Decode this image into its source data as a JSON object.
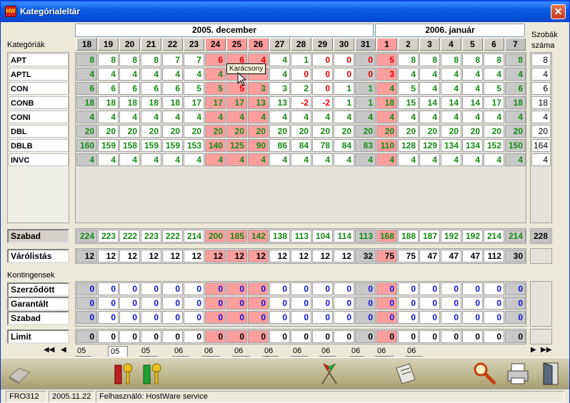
{
  "window": {
    "title": "Kategórialeltár",
    "close_label": "✕",
    "icon_label": "HW"
  },
  "months": [
    {
      "label": "2005. december"
    },
    {
      "label": "2006. január"
    }
  ],
  "days": [
    "18",
    "19",
    "20",
    "21",
    "22",
    "23",
    "24",
    "25",
    "26",
    "27",
    "28",
    "29",
    "30",
    "31",
    "1",
    "2",
    "3",
    "4",
    "5",
    "6",
    "7"
  ],
  "day_types": [
    "we",
    "n",
    "n",
    "n",
    "n",
    "n",
    "hol",
    "hol",
    "hol",
    "n",
    "n",
    "n",
    "n",
    "we",
    "hol",
    "n",
    "n",
    "n",
    "n",
    "n",
    "we"
  ],
  "labels": {
    "categories": "Kategóriák",
    "rooms_count": "Szobák száma",
    "contingents": "Kontingensek"
  },
  "categories": [
    {
      "name": "APT",
      "values": [
        "8",
        "8",
        "8",
        "8",
        "7",
        "7",
        "6",
        "6",
        "4",
        "4",
        "1",
        "0",
        "0",
        "0",
        "5",
        "8",
        "8",
        "8",
        "8",
        "8",
        "8"
      ],
      "colors": [
        "g",
        "g",
        "g",
        "g",
        "g",
        "g",
        "r",
        "r",
        "r",
        "g",
        "g",
        "r",
        "r",
        "r",
        "r",
        "g",
        "g",
        "g",
        "g",
        "g",
        "g"
      ],
      "total": "8"
    },
    {
      "name": "APTL",
      "values": [
        "4",
        "4",
        "4",
        "4",
        "4",
        "4",
        "4",
        "",
        "",
        "4",
        "0",
        "0",
        "0",
        "0",
        "3",
        "4",
        "4",
        "4",
        "4",
        "4",
        "4"
      ],
      "colors": [
        "g",
        "g",
        "g",
        "g",
        "g",
        "g",
        "g",
        "g",
        "g",
        "g",
        "r",
        "r",
        "r",
        "r",
        "r",
        "g",
        "g",
        "g",
        "g",
        "g",
        "g"
      ],
      "total": "4"
    },
    {
      "name": "CON",
      "values": [
        "6",
        "6",
        "6",
        "6",
        "6",
        "5",
        "5",
        "5",
        "3",
        "3",
        "2",
        "0",
        "1",
        "1",
        "4",
        "5",
        "4",
        "4",
        "4",
        "5",
        "6"
      ],
      "colors": [
        "g",
        "g",
        "g",
        "g",
        "g",
        "g",
        "g",
        "r",
        "g",
        "g",
        "g",
        "r",
        "g",
        "g",
        "g",
        "g",
        "g",
        "g",
        "g",
        "g",
        "g"
      ],
      "total": "6"
    },
    {
      "name": "CONB",
      "values": [
        "18",
        "18",
        "18",
        "18",
        "18",
        "17",
        "17",
        "17",
        "13",
        "13",
        "-2",
        "-2",
        "1",
        "1",
        "18",
        "15",
        "14",
        "14",
        "14",
        "17",
        "18"
      ],
      "colors": [
        "g",
        "g",
        "g",
        "g",
        "g",
        "g",
        "g",
        "g",
        "g",
        "g",
        "r",
        "r",
        "g",
        "g",
        "g",
        "g",
        "g",
        "g",
        "g",
        "g",
        "g"
      ],
      "total": "18"
    },
    {
      "name": "CONI",
      "values": [
        "4",
        "4",
        "4",
        "4",
        "4",
        "4",
        "4",
        "4",
        "4",
        "4",
        "4",
        "4",
        "4",
        "4",
        "4",
        "4",
        "4",
        "4",
        "4",
        "4",
        "4"
      ],
      "colors": [
        "g",
        "g",
        "g",
        "g",
        "g",
        "g",
        "g",
        "g",
        "g",
        "g",
        "g",
        "g",
        "g",
        "g",
        "g",
        "g",
        "g",
        "g",
        "g",
        "g",
        "g"
      ],
      "total": "4"
    },
    {
      "name": "DBL",
      "values": [
        "20",
        "20",
        "20",
        "20",
        "20",
        "20",
        "20",
        "20",
        "20",
        "20",
        "20",
        "20",
        "20",
        "20",
        "20",
        "20",
        "20",
        "20",
        "20",
        "20",
        "20"
      ],
      "colors": [
        "g",
        "g",
        "g",
        "g",
        "g",
        "g",
        "g",
        "g",
        "g",
        "g",
        "g",
        "g",
        "g",
        "g",
        "g",
        "g",
        "g",
        "g",
        "g",
        "g",
        "g"
      ],
      "total": "20"
    },
    {
      "name": "DBLB",
      "values": [
        "160",
        "159",
        "158",
        "159",
        "159",
        "153",
        "140",
        "125",
        "90",
        "86",
        "84",
        "78",
        "84",
        "83",
        "110",
        "128",
        "129",
        "134",
        "134",
        "152",
        "150"
      ],
      "colors": [
        "g",
        "g",
        "g",
        "g",
        "g",
        "g",
        "g",
        "g",
        "g",
        "g",
        "g",
        "g",
        "g",
        "g",
        "g",
        "g",
        "g",
        "g",
        "g",
        "g",
        "g"
      ],
      "total": "164"
    },
    {
      "name": "INVC",
      "values": [
        "4",
        "4",
        "4",
        "4",
        "4",
        "4",
        "4",
        "4",
        "4",
        "4",
        "4",
        "4",
        "4",
        "4",
        "4",
        "4",
        "4",
        "4",
        "4",
        "4",
        "4"
      ],
      "colors": [
        "g",
        "g",
        "g",
        "g",
        "g",
        "g",
        "g",
        "g",
        "g",
        "g",
        "g",
        "g",
        "g",
        "g",
        "g",
        "g",
        "g",
        "g",
        "g",
        "g",
        "g"
      ],
      "total": "4"
    }
  ],
  "free": {
    "name": "Szabad",
    "values": [
      "224",
      "223",
      "222",
      "223",
      "222",
      "214",
      "200",
      "185",
      "142",
      "138",
      "113",
      "104",
      "114",
      "113",
      "168",
      "188",
      "187",
      "192",
      "192",
      "214",
      "214"
    ],
    "total": "228"
  },
  "waitlist": {
    "name": "Várólistás",
    "values": [
      "12",
      "12",
      "12",
      "12",
      "12",
      "12",
      "12",
      "12",
      "12",
      "12",
      "12",
      "12",
      "12",
      "32",
      "75",
      "75",
      "47",
      "47",
      "47",
      "112",
      "30"
    ]
  },
  "contingent_rows": [
    {
      "name": "Szerződött",
      "values": [
        "0",
        "0",
        "0",
        "0",
        "0",
        "0",
        "0",
        "0",
        "0",
        "0",
        "0",
        "0",
        "0",
        "0",
        "0",
        "0",
        "0",
        "0",
        "0",
        "0",
        "0"
      ]
    },
    {
      "name": "Garantált",
      "values": [
        "0",
        "0",
        "0",
        "0",
        "0",
        "0",
        "0",
        "0",
        "0",
        "0",
        "0",
        "0",
        "0",
        "0",
        "0",
        "0",
        "0",
        "0",
        "0",
        "0",
        "0"
      ]
    },
    {
      "name": "Szabad",
      "values": [
        "0",
        "0",
        "0",
        "0",
        "0",
        "0",
        "0",
        "0",
        "0",
        "0",
        "0",
        "0",
        "0",
        "0",
        "0",
        "0",
        "0",
        "0",
        "0",
        "0",
        "0"
      ]
    }
  ],
  "limit": {
    "name": "Limit",
    "values": [
      "0",
      "0",
      "0",
      "0",
      "0",
      "0",
      "0",
      "0",
      "0",
      "0",
      "0",
      "0",
      "0",
      "0",
      "0",
      "0",
      "0",
      "0",
      "0",
      "0",
      "0"
    ]
  },
  "tooltip": "Karácsony",
  "tabs": [
    "05 Okt",
    "05 Nov",
    "05 Dec",
    "06 Jan",
    "06 Feb",
    "06 Mar",
    "06 Ápr",
    "06 Máj",
    "06 Jún",
    "06 Júl",
    "06 Aug",
    "06 Sze"
  ],
  "active_tab": "05 Nov",
  "nav": {
    "first": "◀◀",
    "prev": "◀",
    "next": "▶",
    "last": "▶▶"
  },
  "status": {
    "code": "FRO312",
    "date": "2005.11.22",
    "user": "Felhasználó: HostWare service"
  },
  "colors": {
    "holiday": "#ff9e9e",
    "positive": "#138a13",
    "negative": "#e00000",
    "contingent": "#1010d8"
  }
}
